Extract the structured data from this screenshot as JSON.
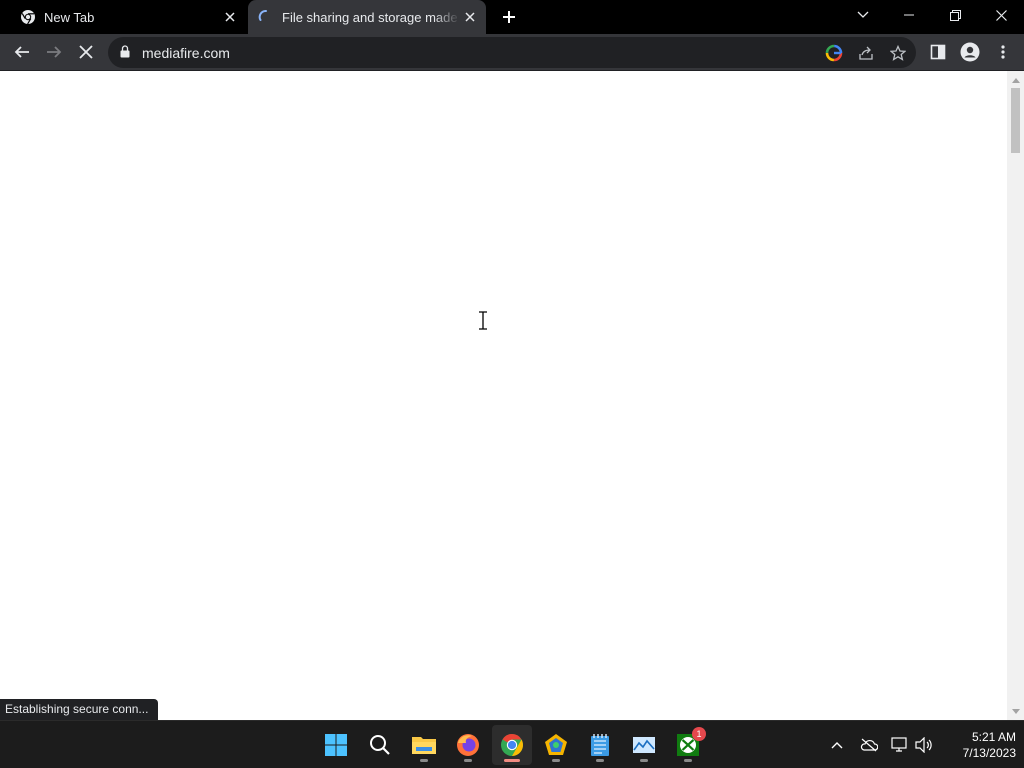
{
  "browser": {
    "tabs": [
      {
        "title": "New Tab",
        "favicon": "chrome-icon",
        "active": false
      },
      {
        "title": "File sharing and storage made simple",
        "favicon": "loading-spinner-icon",
        "active": true
      }
    ],
    "address": {
      "url": "mediafire.com",
      "secure": true
    },
    "status_text": "Establishing secure conn..."
  },
  "taskbar": {
    "apps": [
      {
        "name": "start-icon"
      },
      {
        "name": "search-icon"
      },
      {
        "name": "file-explorer-icon"
      },
      {
        "name": "firefox-icon"
      },
      {
        "name": "chrome-icon",
        "active": true
      },
      {
        "name": "paint-app-icon"
      },
      {
        "name": "notepad-icon"
      },
      {
        "name": "image-viewer-icon"
      },
      {
        "name": "xbox-icon",
        "badge": "1"
      }
    ],
    "clock": {
      "time": "5:21 AM",
      "date": "7/13/2023"
    }
  },
  "colors": {
    "titlebar": "#000000",
    "toolbar": "#35363a",
    "omnibox": "#202124",
    "taskbar": "#1c1c1c",
    "accent": "#8ab4f8"
  }
}
